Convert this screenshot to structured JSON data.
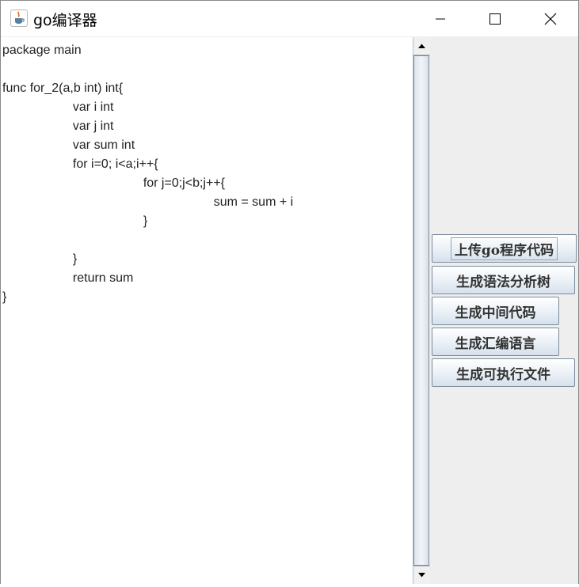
{
  "window": {
    "title": "go编译器",
    "icons": {
      "app": "java-cup-icon",
      "minimize": "minimize-icon",
      "maximize": "maximize-icon",
      "close": "close-icon"
    }
  },
  "editor": {
    "lines": [
      "package main",
      "",
      "func for_2(a,b int) int{",
      "                    var i int",
      "                    var j int",
      "                    var sum int",
      "                    for i=0; i<a;i++{",
      "                                        for j=0;j<b;j++{",
      "                                                            sum = sum + i",
      "                                        }",
      "",
      "                    }",
      "                    return sum",
      "}"
    ]
  },
  "buttons": {
    "upload": "上传go程序代码",
    "parse_tree": "生成语法分析树",
    "intermediate": "生成中间代码",
    "assembly": "生成汇编语言",
    "executable": "生成可执行文件"
  },
  "colors": {
    "button_border": "#7c8c9c",
    "panel_bg": "#eeeeee"
  }
}
